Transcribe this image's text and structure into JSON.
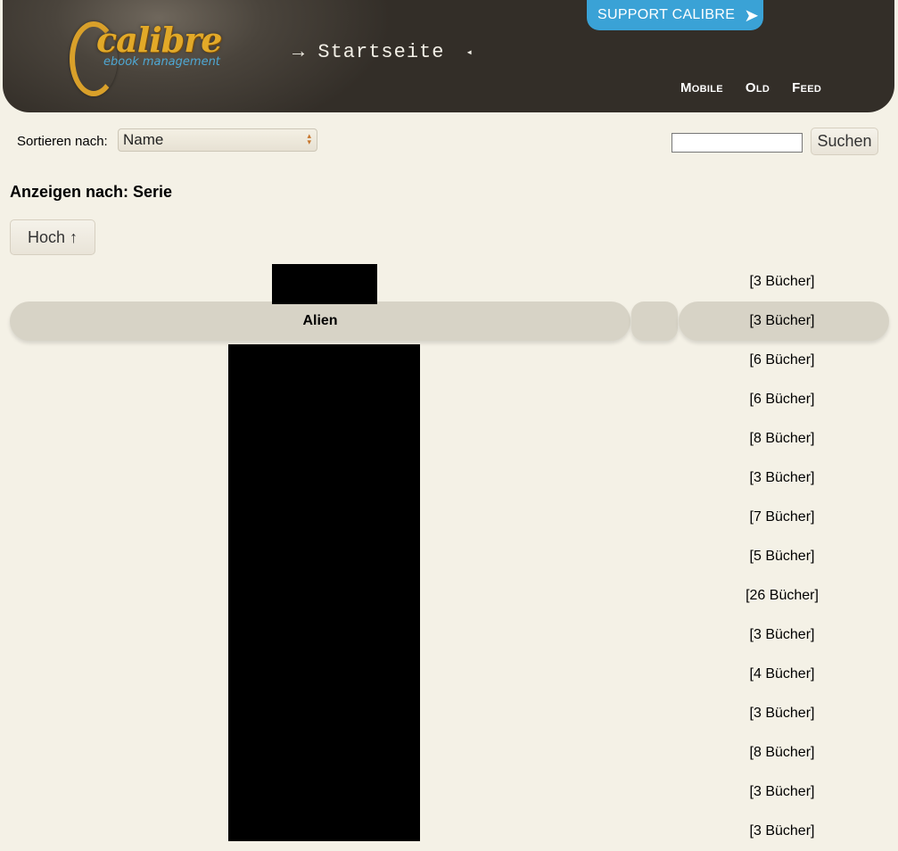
{
  "header": {
    "logo_text": "calibre",
    "logo_subtitle": "ebook management",
    "breadcrumb_prefix": "→",
    "breadcrumb": "Startseite",
    "breadcrumb_end": "◂",
    "support_label": "SUPPORT CALIBRE",
    "support_icon": "arrow-right-icon",
    "nav": [
      "Mobile",
      "Old",
      "Feed"
    ]
  },
  "controls": {
    "sort_label": "Sortieren nach:",
    "sort_value": "Name",
    "search_placeholder": "",
    "search_button": "Suchen"
  },
  "view": {
    "heading": "Anzeigen nach: Serie",
    "up_button": "Hoch ↑"
  },
  "series": [
    {
      "name": "",
      "count": "[3 Bücher]"
    },
    {
      "name": "Alien",
      "count": "[3 Bücher]"
    },
    {
      "name": "",
      "count": "[6 Bücher]"
    },
    {
      "name": "",
      "count": "[6 Bücher]"
    },
    {
      "name": "",
      "count": "[8 Bücher]"
    },
    {
      "name": "",
      "count": "[3 Bücher]"
    },
    {
      "name": "",
      "count": "[7 Bücher]"
    },
    {
      "name": "",
      "count": "[5 Bücher]"
    },
    {
      "name": "",
      "count": "[26 Bücher]"
    },
    {
      "name": "",
      "count": "[3 Bücher]"
    },
    {
      "name": "",
      "count": "[4 Bücher]"
    },
    {
      "name": "",
      "count": "[3 Bücher]"
    },
    {
      "name": "",
      "count": "[8 Bücher]"
    },
    {
      "name": "",
      "count": "[3 Bücher]"
    },
    {
      "name": "",
      "count": "[3 Bücher]"
    }
  ]
}
